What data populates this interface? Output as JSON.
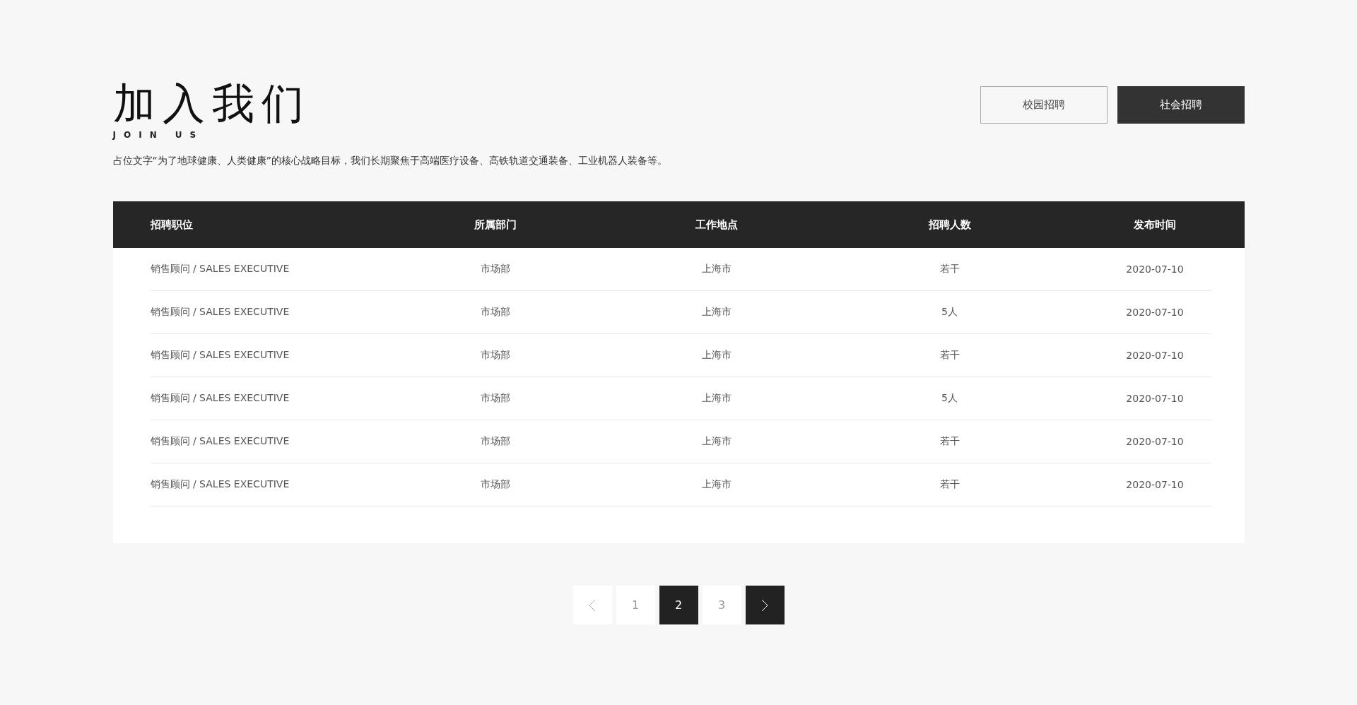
{
  "header": {
    "title": "加入我们",
    "subtitle": "JOIN US",
    "description": "占位文字“为了地球健康、人类健康”的核心战略目标，我们长期聚焦于高端医疗设备、高铁轨道交通装备、工业机器人装备等。"
  },
  "tabs": [
    {
      "label": "校园招聘",
      "selected": false
    },
    {
      "label": "社会招聘",
      "selected": true
    }
  ],
  "table": {
    "columns": [
      "招聘职位",
      "所属部门",
      "工作地点",
      "招聘人数",
      "发布时间"
    ],
    "rows": [
      [
        "销售顾问 / SALES EXECUTIVE",
        "市场部",
        "上海市",
        "若干",
        "2020-07-10"
      ],
      [
        "销售顾问 / SALES EXECUTIVE",
        "市场部",
        "上海市",
        "5人",
        "2020-07-10"
      ],
      [
        "销售顾问 / SALES EXECUTIVE",
        "市场部",
        "上海市",
        "若干",
        "2020-07-10"
      ],
      [
        "销售顾问 / SALES EXECUTIVE",
        "市场部",
        "上海市",
        "5人",
        "2020-07-10"
      ],
      [
        "销售顾问 / SALES EXECUTIVE",
        "市场部",
        "上海市",
        "若干",
        "2020-07-10"
      ],
      [
        "销售顾问 / SALES EXECUTIVE",
        "市场部",
        "上海市",
        "若干",
        "2020-07-10"
      ]
    ]
  },
  "pagination": {
    "prev": {
      "disabled": true
    },
    "pages": [
      {
        "label": "1",
        "selected": false
      },
      {
        "label": "2",
        "selected": true
      },
      {
        "label": "3",
        "selected": false
      }
    ],
    "next": {
      "disabled": false
    }
  }
}
